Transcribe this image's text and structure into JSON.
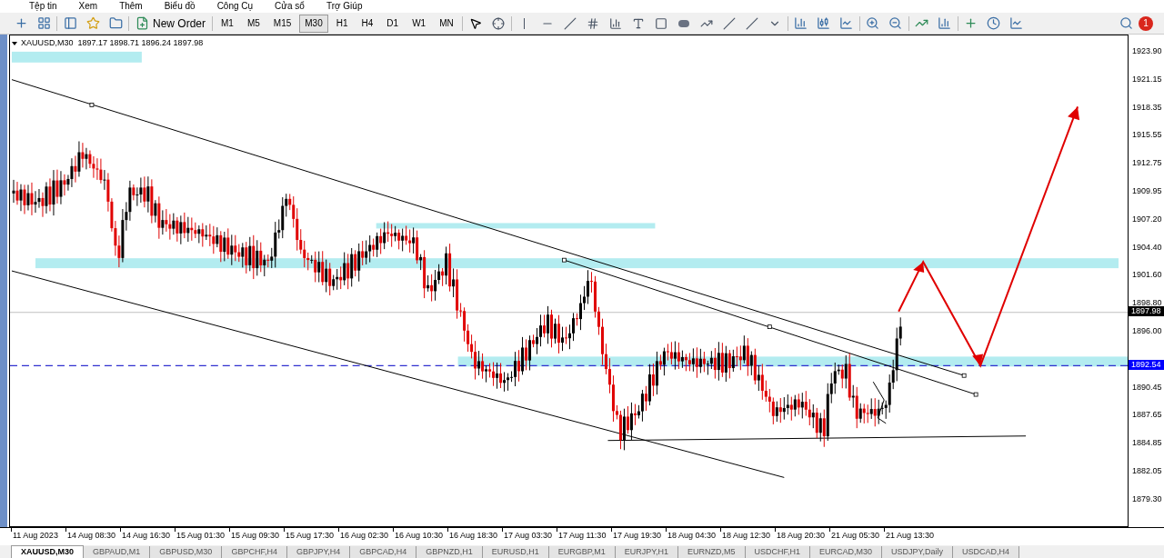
{
  "menu": [
    "Tệp tin",
    "Xem",
    "Thêm",
    "Biểu đồ",
    "Công Cụ",
    "Cửa sổ",
    "Trợ Giúp"
  ],
  "toolbar": {
    "new_order": "New Order",
    "timeframes": [
      {
        "label": "M1",
        "selected": false
      },
      {
        "label": "M5",
        "selected": false
      },
      {
        "label": "M15",
        "selected": false
      },
      {
        "label": "M30",
        "selected": true
      },
      {
        "label": "H1",
        "selected": false
      },
      {
        "label": "H4",
        "selected": false
      },
      {
        "label": "D1",
        "selected": false
      },
      {
        "label": "W1",
        "selected": false
      },
      {
        "label": "MN",
        "selected": false
      }
    ],
    "notifications": "1"
  },
  "chart": {
    "header": "XAUUSD,M30  1897.17 1898.71 1896.24 1897.98",
    "price_labels": [
      "1923.90",
      "1921.15",
      "1918.35",
      "1915.55",
      "1912.75",
      "1909.95",
      "1907.20",
      "1904.40",
      "1901.60",
      "1898.80",
      "1896.00",
      "1890.45",
      "1887.65",
      "1884.85",
      "1882.05",
      "1879.30"
    ],
    "price_tags": [
      {
        "text": "1897.98",
        "kind": "bid",
        "color": "#000000"
      },
      {
        "text": "1892.54",
        "kind": "level",
        "color": "#0000ff"
      }
    ],
    "time_labels": [
      "11 Aug 2023",
      "14 Aug 08:30",
      "14 Aug 16:30",
      "15 Aug 01:30",
      "15 Aug 09:30",
      "15 Aug 17:30",
      "16 Aug 02:30",
      "16 Aug 10:30",
      "16 Aug 18:30",
      "17 Aug 03:30",
      "17 Aug 11:30",
      "17 Aug 19:30",
      "18 Aug 04:30",
      "18 Aug 12:30",
      "18 Aug 20:30",
      "21 Aug 05:30",
      "21 Aug 13:30"
    ]
  },
  "tabs": [
    {
      "label": "XAUUSD,M30",
      "selected": true
    },
    {
      "label": "GBPAUD,M1",
      "selected": false
    },
    {
      "label": "GBPUSD,M30",
      "selected": false
    },
    {
      "label": "GBPCHF,H4",
      "selected": false
    },
    {
      "label": "GBPJPY,H4",
      "selected": false
    },
    {
      "label": "GBPCAD,H4",
      "selected": false
    },
    {
      "label": "GBPNZD,H1",
      "selected": false
    },
    {
      "label": "EURUSD,H1",
      "selected": false
    },
    {
      "label": "EURGBP,M1",
      "selected": false
    },
    {
      "label": "EURJPY,H1",
      "selected": false
    },
    {
      "label": "EURNZD,M5",
      "selected": false
    },
    {
      "label": "USDCHF,H1",
      "selected": false
    },
    {
      "label": "EURCAD,M30",
      "selected": false
    },
    {
      "label": "USDJPY,Daily",
      "selected": false
    },
    {
      "label": "USDCAD,H4",
      "selected": false
    }
  ]
}
